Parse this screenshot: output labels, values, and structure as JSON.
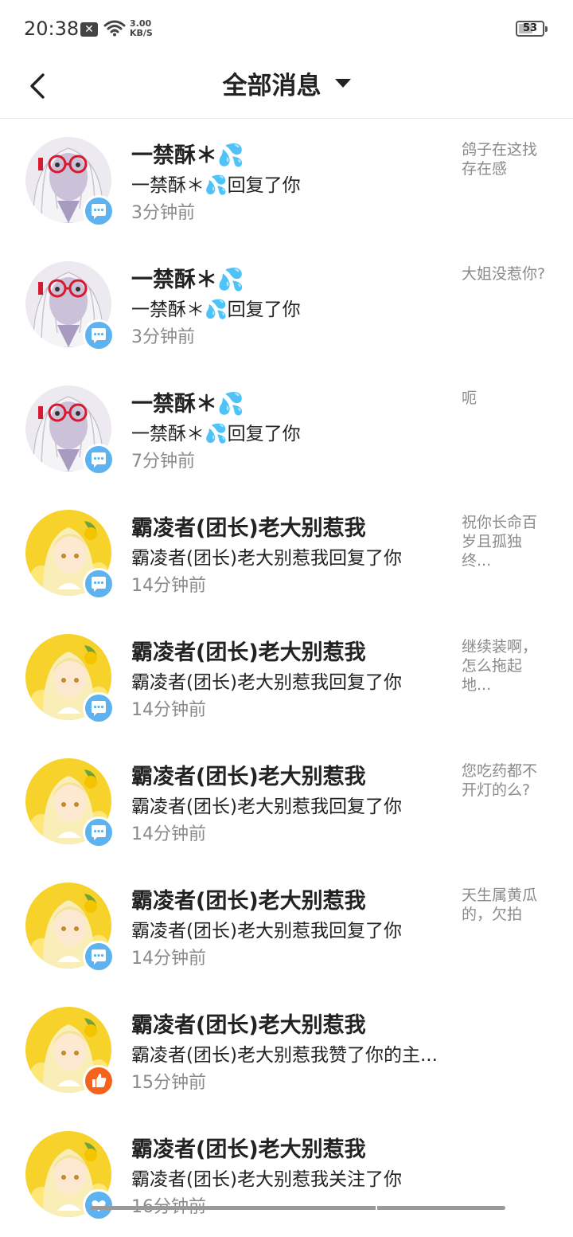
{
  "status_bar": {
    "time": "20:38",
    "notification_icon": "x-close-notification-icon",
    "wifi_icon": "wifi-icon",
    "net_speed_value": "3.00",
    "net_speed_unit": "KB/S",
    "battery_level": "53"
  },
  "header": {
    "back_icon": "chevron-left-icon",
    "title": "全部消息",
    "dropdown_icon": "caret-down-icon"
  },
  "colors": {
    "reply_badge": "#5db2f0",
    "like_badge": "#f5621c",
    "follow_badge": "#5db2f0",
    "name_text": "#222222",
    "secondary_text": "#8a8a8a"
  },
  "messages": [
    {
      "avatar": "white-hair-glasses",
      "badge": "reply-bubble-icon",
      "name": "一禁酥＊💦",
      "desc": "一禁酥＊💦回复了你",
      "time": "3分钟前",
      "preview": "鸽子在这找存在感"
    },
    {
      "avatar": "white-hair-glasses",
      "badge": "reply-bubble-icon",
      "name": "一禁酥＊💦",
      "desc": "一禁酥＊💦回复了你",
      "time": "3分钟前",
      "preview": "大姐没惹你?"
    },
    {
      "avatar": "white-hair-glasses",
      "badge": "reply-bubble-icon",
      "name": "一禁酥＊💦",
      "desc": "一禁酥＊💦回复了你",
      "time": "7分钟前",
      "preview": "呃"
    },
    {
      "avatar": "lemon-girl",
      "badge": "reply-bubble-icon",
      "name": "霸凌者(团长)老大别惹我",
      "desc": "霸凌者(团长)老大别惹我回复了你",
      "time": "14分钟前",
      "preview": "祝你长命百岁且孤独终..."
    },
    {
      "avatar": "lemon-girl",
      "badge": "reply-bubble-icon",
      "name": "霸凌者(团长)老大别惹我",
      "desc": "霸凌者(团长)老大别惹我回复了你",
      "time": "14分钟前",
      "preview": "继续装啊，怎么拖起地..."
    },
    {
      "avatar": "lemon-girl",
      "badge": "reply-bubble-icon",
      "name": "霸凌者(团长)老大别惹我",
      "desc": "霸凌者(团长)老大别惹我回复了你",
      "time": "14分钟前",
      "preview": "您吃药都不开灯的么?"
    },
    {
      "avatar": "lemon-girl",
      "badge": "reply-bubble-icon",
      "name": "霸凌者(团长)老大别惹我",
      "desc": "霸凌者(团长)老大别惹我回复了你",
      "time": "14分钟前",
      "preview": "天生属黄瓜的，欠拍"
    },
    {
      "avatar": "lemon-girl",
      "badge": "thumbs-up-icon",
      "name": "霸凌者(团长)老大别惹我",
      "desc": "霸凌者(团长)老大别惹我赞了你的主...",
      "time": "15分钟前",
      "preview": ""
    },
    {
      "avatar": "lemon-girl",
      "badge": "heart-icon",
      "name": "霸凌者(团长)老大别惹我",
      "desc": "霸凌者(团长)老大别惹我关注了你",
      "time": "16分钟前",
      "preview": ""
    }
  ]
}
